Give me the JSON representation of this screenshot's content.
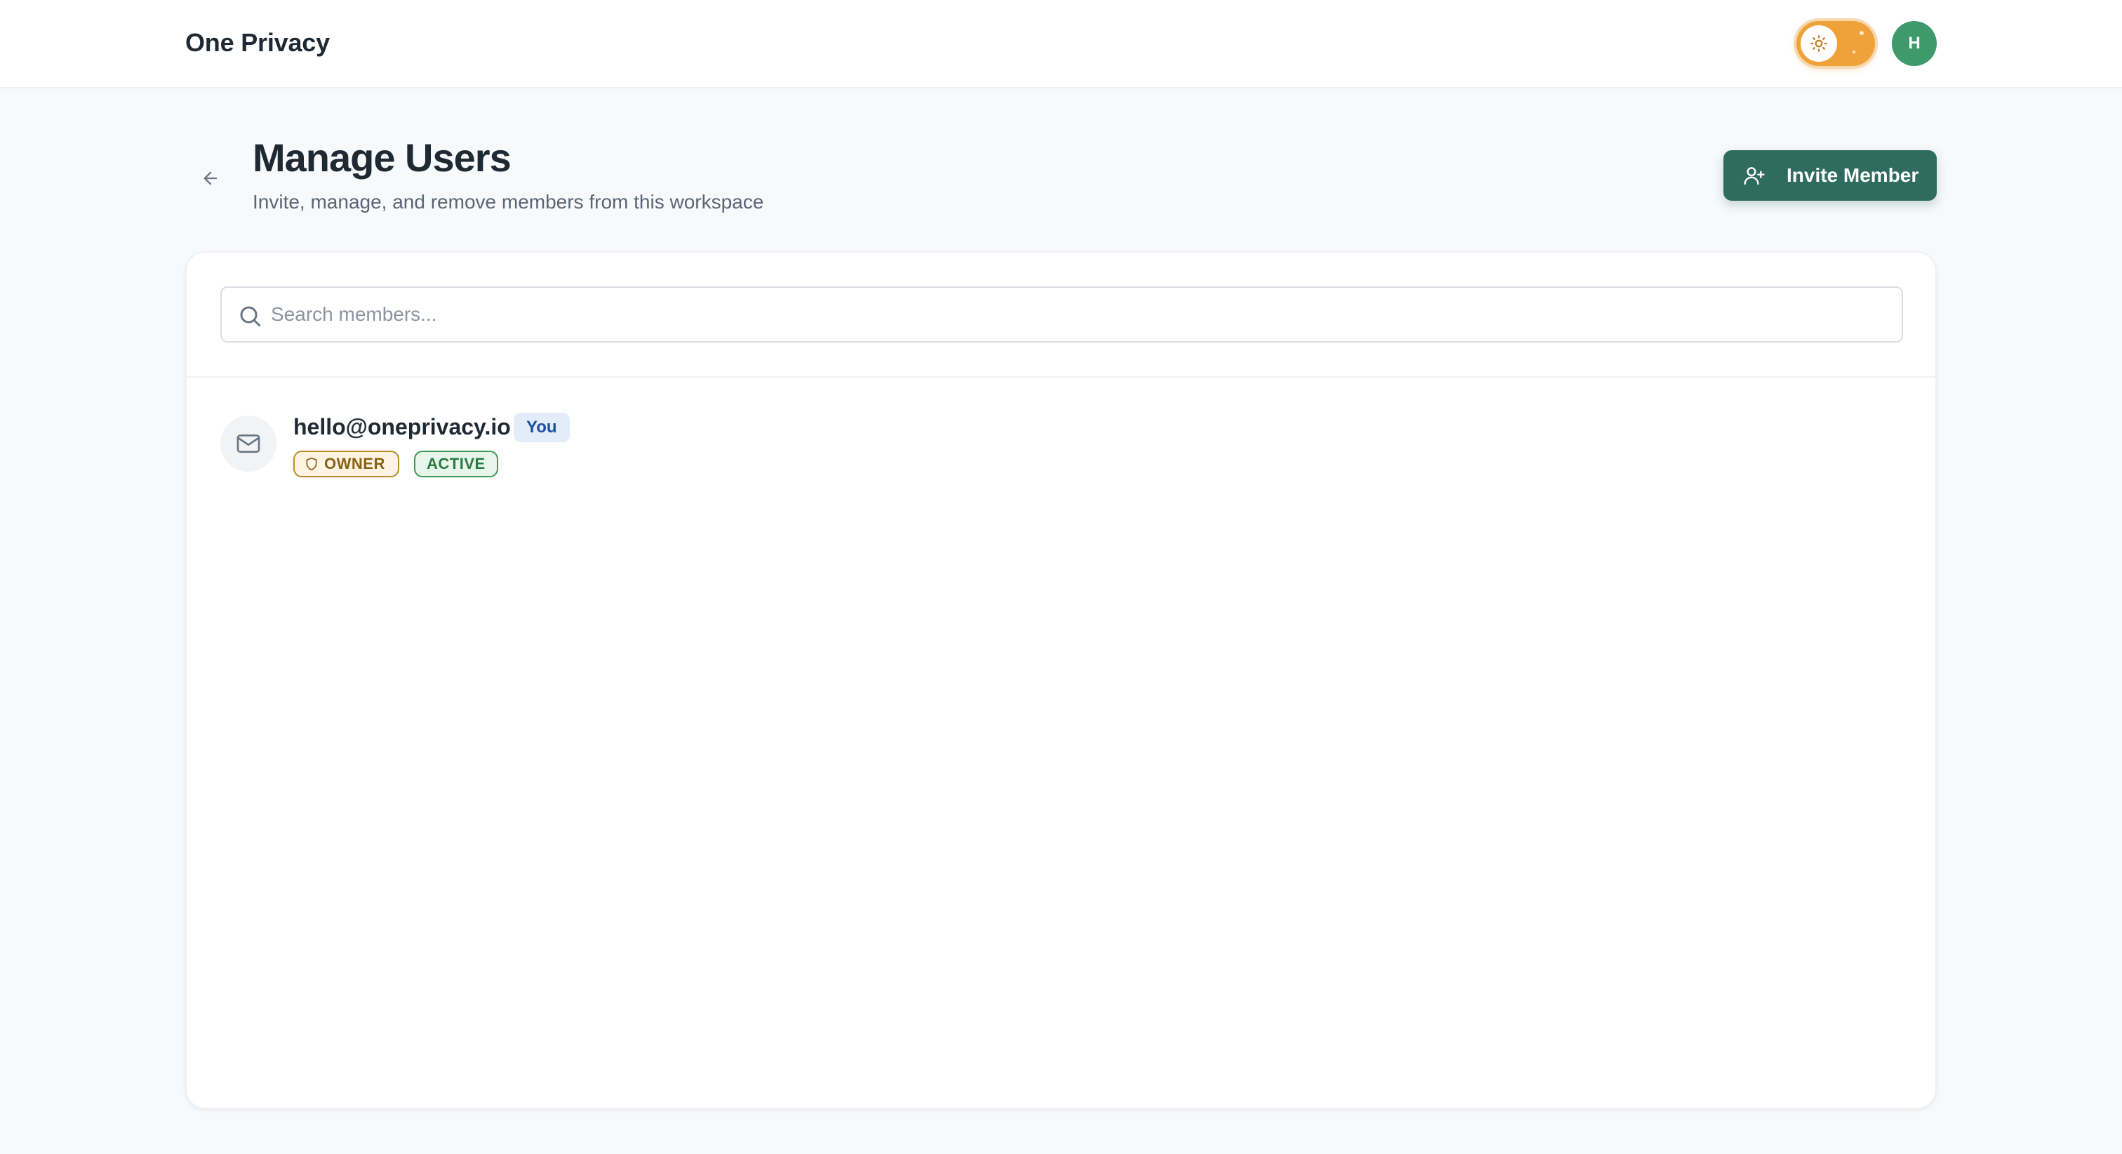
{
  "header": {
    "brand": "One Privacy",
    "avatar_initial": "H",
    "theme_toggle": {
      "mode": "light",
      "icon": "sun-icon"
    }
  },
  "page": {
    "title": "Manage Users",
    "subtitle": "Invite, manage, and remove members from this workspace",
    "back_icon": "arrow-left-icon"
  },
  "actions": {
    "invite_label": "Invite Member",
    "invite_icon": "user-plus-icon"
  },
  "search": {
    "placeholder": "Search members...",
    "value": ""
  },
  "members": [
    {
      "email": "hello@oneprivacy.io",
      "you_label": "You",
      "role": "OWNER",
      "status": "ACTIVE",
      "icon": "mail-icon"
    }
  ],
  "colors": {
    "primary": "#2f6b5e",
    "avatar": "#3e9a6b",
    "toggle": "#f0a23a",
    "owner_badge": "#b88a2a",
    "active_badge": "#3f9a57",
    "you_badge": "#e3ecf9"
  }
}
